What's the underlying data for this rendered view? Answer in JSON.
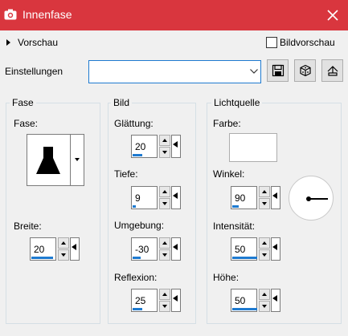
{
  "window": {
    "title": "Innenfase"
  },
  "preview": {
    "label": "Vorschau"
  },
  "image_preview": {
    "label": "Bildvorschau",
    "checked": false
  },
  "settings": {
    "label": "Einstellungen",
    "value": ""
  },
  "groups": {
    "fase": {
      "title": "Fase",
      "shape_label": "Fase:",
      "width_label": "Breite:",
      "width_value": "20"
    },
    "bild": {
      "title": "Bild",
      "fields": [
        {
          "label": "Glättung:",
          "value": "20",
          "level": 0.2
        },
        {
          "label": "Tiefe:",
          "value": "9",
          "level": 0.09
        },
        {
          "label": "Umgebung:",
          "value": "-30",
          "level": 0.35
        },
        {
          "label": "Reflexion:",
          "value": "25",
          "level": 0.25
        }
      ]
    },
    "lichtquelle": {
      "title": "Lichtquelle",
      "color_label": "Farbe:",
      "color_value": "#ffffff",
      "fields": [
        {
          "label": "Winkel:",
          "value": "90",
          "level": 0.25
        },
        {
          "label": "Intensität:",
          "value": "50",
          "level": 0.5
        },
        {
          "label": "Höhe:",
          "value": "50",
          "level": 0.55
        }
      ]
    }
  },
  "icons": {
    "title": "camera-icon",
    "close": "close-icon",
    "save": "save-icon",
    "random": "dice-icon",
    "reset": "reset-icon"
  },
  "colors": {
    "titlebar": "#d9363e",
    "accent": "#1e7ad0"
  }
}
